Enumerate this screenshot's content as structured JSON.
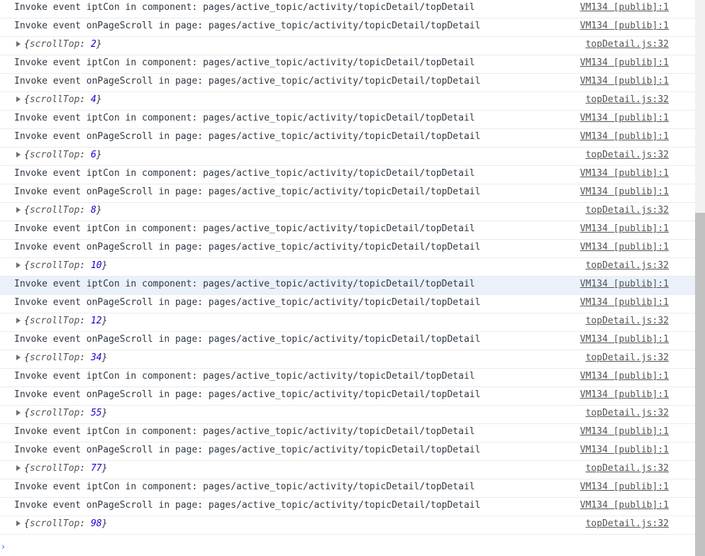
{
  "console": {
    "rows": [
      {
        "type": "msg",
        "text": "Invoke event iptCon in component: pages/active_topic/activity/topicDetail/topDetail",
        "source": "VM134 [publib]:1"
      },
      {
        "type": "msg",
        "text": "Invoke event onPageScroll in page: pages/active_topic/activity/topicDetail/topDetail",
        "source": "VM134 [publib]:1"
      },
      {
        "type": "obj",
        "key": "scrollTop",
        "value": "2",
        "source": "topDetail.js:32"
      },
      {
        "type": "msg",
        "text": "Invoke event iptCon in component: pages/active_topic/activity/topicDetail/topDetail",
        "source": "VM134 [publib]:1"
      },
      {
        "type": "msg",
        "text": "Invoke event onPageScroll in page: pages/active_topic/activity/topicDetail/topDetail",
        "source": "VM134 [publib]:1"
      },
      {
        "type": "obj",
        "key": "scrollTop",
        "value": "4",
        "source": "topDetail.js:32"
      },
      {
        "type": "msg",
        "text": "Invoke event iptCon in component: pages/active_topic/activity/topicDetail/topDetail",
        "source": "VM134 [publib]:1"
      },
      {
        "type": "msg",
        "text": "Invoke event onPageScroll in page: pages/active_topic/activity/topicDetail/topDetail",
        "source": "VM134 [publib]:1"
      },
      {
        "type": "obj",
        "key": "scrollTop",
        "value": "6",
        "source": "topDetail.js:32"
      },
      {
        "type": "msg",
        "text": "Invoke event iptCon in component: pages/active_topic/activity/topicDetail/topDetail",
        "source": "VM134 [publib]:1"
      },
      {
        "type": "msg",
        "text": "Invoke event onPageScroll in page: pages/active_topic/activity/topicDetail/topDetail",
        "source": "VM134 [publib]:1"
      },
      {
        "type": "obj",
        "key": "scrollTop",
        "value": "8",
        "source": "topDetail.js:32"
      },
      {
        "type": "msg",
        "text": "Invoke event iptCon in component: pages/active_topic/activity/topicDetail/topDetail",
        "source": "VM134 [publib]:1"
      },
      {
        "type": "msg",
        "text": "Invoke event onPageScroll in page: pages/active_topic/activity/topicDetail/topDetail",
        "source": "VM134 [publib]:1"
      },
      {
        "type": "obj",
        "key": "scrollTop",
        "value": "10",
        "source": "topDetail.js:32"
      },
      {
        "type": "msg",
        "text": "Invoke event iptCon in component: pages/active_topic/activity/topicDetail/topDetail",
        "source": "VM134 [publib]:1",
        "highlighted": true
      },
      {
        "type": "msg",
        "text": "Invoke event onPageScroll in page: pages/active_topic/activity/topicDetail/topDetail",
        "source": "VM134 [publib]:1"
      },
      {
        "type": "obj",
        "key": "scrollTop",
        "value": "12",
        "source": "topDetail.js:32"
      },
      {
        "type": "msg",
        "text": "Invoke event onPageScroll in page: pages/active_topic/activity/topicDetail/topDetail",
        "source": "VM134 [publib]:1"
      },
      {
        "type": "obj",
        "key": "scrollTop",
        "value": "34",
        "source": "topDetail.js:32"
      },
      {
        "type": "msg",
        "text": "Invoke event iptCon in component: pages/active_topic/activity/topicDetail/topDetail",
        "source": "VM134 [publib]:1"
      },
      {
        "type": "msg",
        "text": "Invoke event onPageScroll in page: pages/active_topic/activity/topicDetail/topDetail",
        "source": "VM134 [publib]:1"
      },
      {
        "type": "obj",
        "key": "scrollTop",
        "value": "55",
        "source": "topDetail.js:32"
      },
      {
        "type": "msg",
        "text": "Invoke event iptCon in component: pages/active_topic/activity/topicDetail/topDetail",
        "source": "VM134 [publib]:1"
      },
      {
        "type": "msg",
        "text": "Invoke event onPageScroll in page: pages/active_topic/activity/topicDetail/topDetail",
        "source": "VM134 [publib]:1"
      },
      {
        "type": "obj",
        "key": "scrollTop",
        "value": "77",
        "source": "topDetail.js:32"
      },
      {
        "type": "msg",
        "text": "Invoke event iptCon in component: pages/active_topic/activity/topicDetail/topDetail",
        "source": "VM134 [publib]:1"
      },
      {
        "type": "msg",
        "text": "Invoke event onPageScroll in page: pages/active_topic/activity/topicDetail/topDetail",
        "source": "VM134 [publib]:1"
      },
      {
        "type": "obj",
        "key": "scrollTop",
        "value": "98",
        "source": "topDetail.js:32"
      }
    ],
    "prompt": {
      "caret": "›",
      "value": ""
    }
  },
  "icons": {
    "expand": "expand-triangle-icon",
    "prompt": "prompt-chevron-icon"
  },
  "colors": {
    "text": "#303942",
    "number": "#1c00cf",
    "link": "#545454",
    "highlight": "#eaf1fb",
    "prompt": "#367cf1"
  }
}
